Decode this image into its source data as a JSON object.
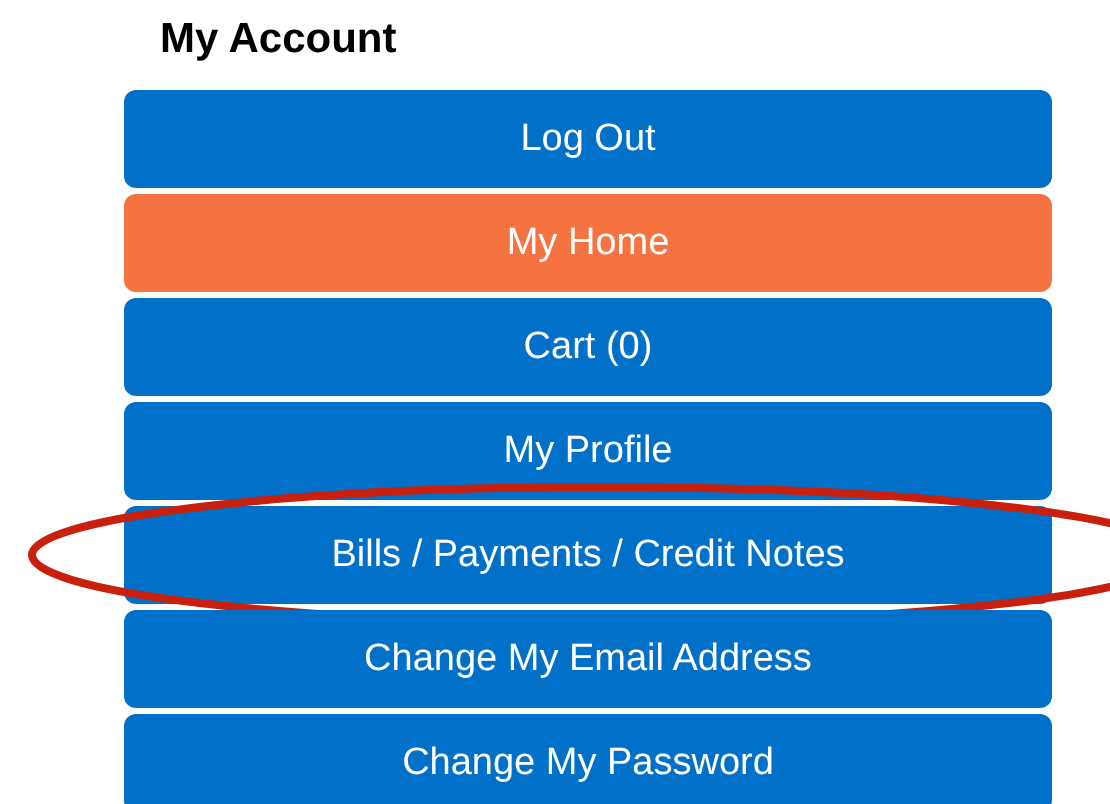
{
  "title": "My Account",
  "items": [
    {
      "label": "Log Out",
      "selected": false,
      "circled": false
    },
    {
      "label": "My Home",
      "selected": true,
      "circled": false
    },
    {
      "label": "Cart (0)",
      "selected": false,
      "circled": false
    },
    {
      "label": "My Profile",
      "selected": false,
      "circled": false
    },
    {
      "label": "Bills / Payments / Credit Notes",
      "selected": false,
      "circled": true
    },
    {
      "label": "Change My Email Address",
      "selected": false,
      "circled": false
    },
    {
      "label": "Change My Password",
      "selected": false,
      "circled": false
    }
  ]
}
